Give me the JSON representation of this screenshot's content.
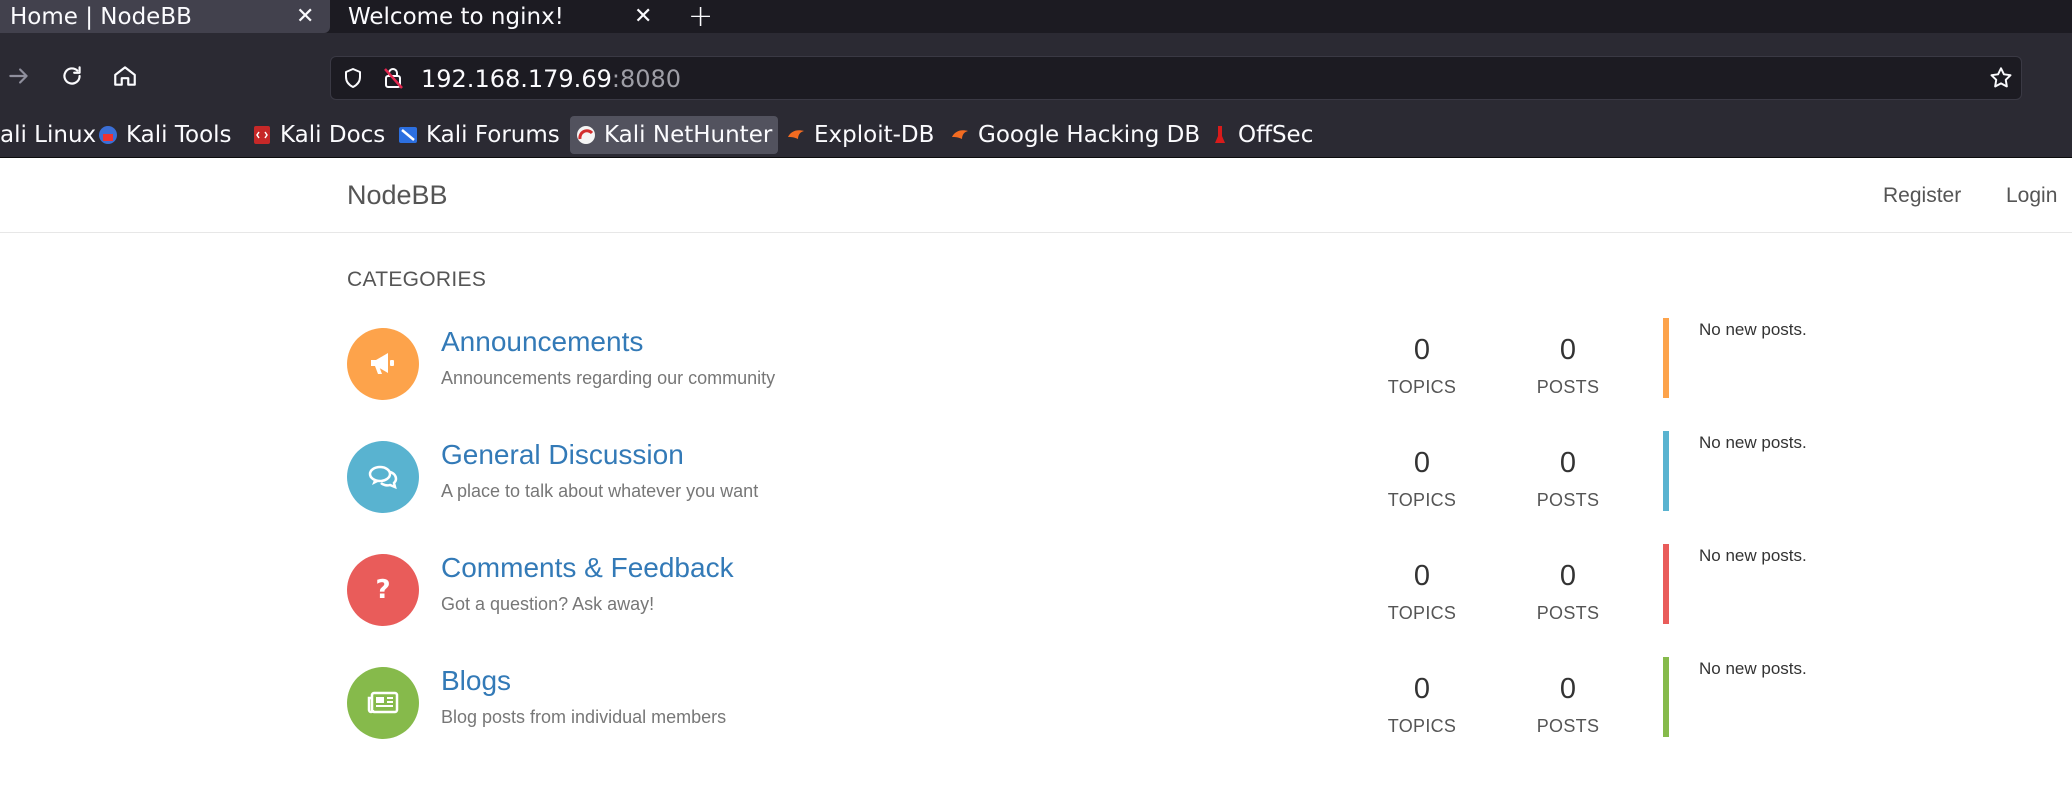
{
  "browser": {
    "tabs": [
      {
        "title": "Home | NodeBB",
        "active": true
      },
      {
        "title": "Welcome to nginx!",
        "active": false
      }
    ],
    "new_tab_symbol": "+",
    "close_symbol": "✕",
    "url": {
      "host": "192.168.179.69",
      "port": ":8080"
    },
    "bookmarks": [
      {
        "label": "ali Linux",
        "icon": "kali-icon"
      },
      {
        "label": "Kali Tools",
        "icon": "kali-tools-icon"
      },
      {
        "label": "Kali Docs",
        "icon": "kali-docs-icon"
      },
      {
        "label": "Kali Forums",
        "icon": "kali-forums-icon"
      },
      {
        "label": "Kali NetHunter",
        "icon": "nethunter-icon"
      },
      {
        "label": "Exploit-DB",
        "icon": "exploit-db-icon"
      },
      {
        "label": "Google Hacking DB",
        "icon": "ghdb-icon"
      },
      {
        "label": "OffSec",
        "icon": "offsec-icon"
      }
    ]
  },
  "site": {
    "brand": "NodeBB",
    "register": "Register",
    "login": "Login",
    "categories_heading": "CATEGORIES",
    "categories": [
      {
        "name": "Announcements",
        "description": "Announcements regarding our community",
        "topics": "0",
        "topics_label": "TOPICS",
        "posts": "0",
        "posts_label": "POSTS",
        "teaser": "No new posts.",
        "color": "#fda34b",
        "icon": "bullhorn-icon"
      },
      {
        "name": "General Discussion",
        "description": "A place to talk about whatever you want",
        "topics": "0",
        "topics_label": "TOPICS",
        "posts": "0",
        "posts_label": "POSTS",
        "teaser": "No new posts.",
        "color": "#59b3d0",
        "icon": "comments-icon"
      },
      {
        "name": "Comments & Feedback",
        "description": "Got a question? Ask away!",
        "topics": "0",
        "topics_label": "TOPICS",
        "posts": "0",
        "posts_label": "POSTS",
        "teaser": "No new posts.",
        "color": "#e95c5a",
        "icon": "question-icon"
      },
      {
        "name": "Blogs",
        "description": "Blog posts from individual members",
        "topics": "0",
        "topics_label": "TOPICS",
        "posts": "0",
        "posts_label": "POSTS",
        "teaser": "No new posts.",
        "color": "#86ba4b",
        "icon": "newspaper-icon"
      }
    ]
  }
}
